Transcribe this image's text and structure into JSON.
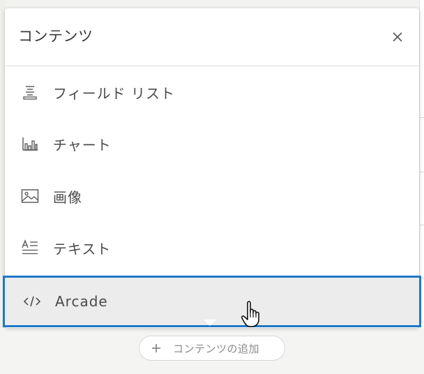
{
  "panel": {
    "title": "コンテンツ",
    "close_label": "×"
  },
  "menu": {
    "items": [
      {
        "label": "フィールド リスト",
        "icon": "field-list-icon"
      },
      {
        "label": "チャート",
        "icon": "bar-chart-icon"
      },
      {
        "label": "画像",
        "icon": "image-icon"
      },
      {
        "label": "テキスト",
        "icon": "text-icon"
      },
      {
        "label": "Arcade",
        "icon": "code-icon",
        "selected": true
      }
    ]
  },
  "add_button": {
    "label": "コンテンツの追加",
    "icon": "plus-icon"
  },
  "colors": {
    "accent": "#1f78c8",
    "selected_bg": "#ececec",
    "text": "#4b4b4b"
  }
}
